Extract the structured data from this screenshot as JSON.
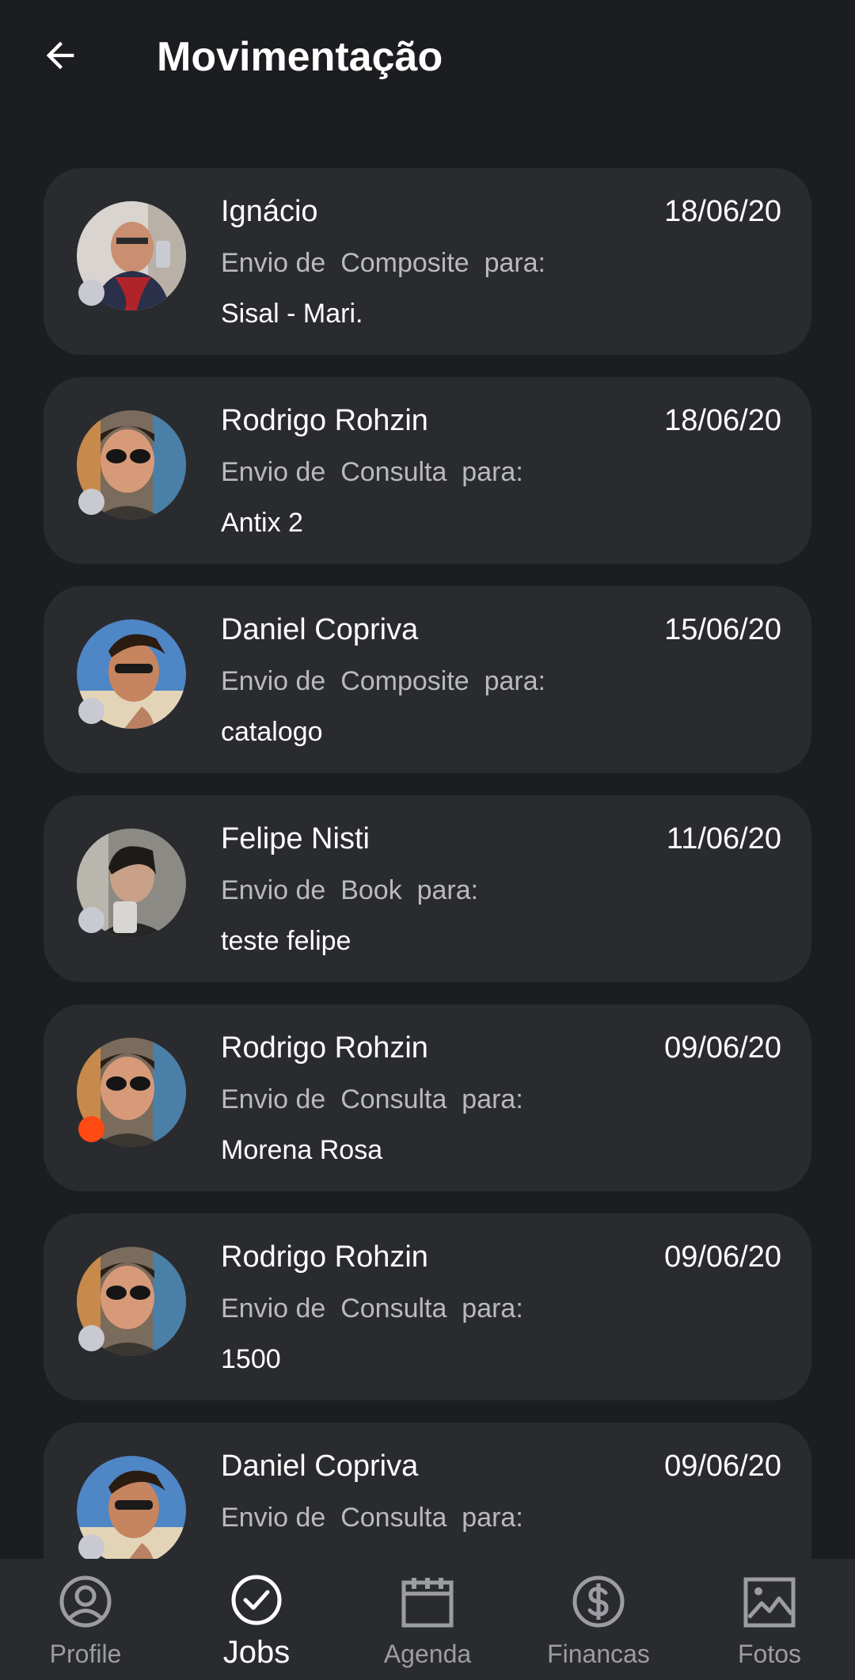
{
  "header": {
    "title": "Movimentação",
    "back_icon": "arrow-left-icon"
  },
  "items": [
    {
      "name": "Ignácio",
      "date": "18/06/20",
      "desc": "Envio de  Composite  para:",
      "target": "Sisal - Mari.",
      "status": "read"
    },
    {
      "name": "Rodrigo Rohzin",
      "date": "18/06/20",
      "desc": "Envio de  Consulta  para:",
      "target": "Antix 2",
      "status": "read"
    },
    {
      "name": "Daniel Copriva",
      "date": "15/06/20",
      "desc": "Envio de  Composite  para:",
      "target": "catalogo",
      "status": "read"
    },
    {
      "name": "Felipe Nisti",
      "date": "11/06/20",
      "desc": "Envio de  Book  para:",
      "target": "teste felipe",
      "status": "read"
    },
    {
      "name": "Rodrigo Rohzin",
      "date": "09/06/20",
      "desc": "Envio de  Consulta  para:",
      "target": "Morena Rosa",
      "status": "unread"
    },
    {
      "name": "Rodrigo Rohzin",
      "date": "09/06/20",
      "desc": "Envio de  Consulta  para:",
      "target": "1500",
      "status": "read"
    },
    {
      "name": "Daniel Copriva",
      "date": "09/06/20",
      "desc": "Envio de  Consulta  para:",
      "target": "",
      "status": "read"
    }
  ],
  "nav": [
    {
      "label": "Profile",
      "icon": "profile-icon",
      "active": false
    },
    {
      "label": "Jobs",
      "icon": "check-circle-icon",
      "active": true
    },
    {
      "label": "Agenda",
      "icon": "calendar-icon",
      "active": false
    },
    {
      "label": "Financas",
      "icon": "dollar-icon",
      "active": false
    },
    {
      "label": "Fotos",
      "icon": "image-icon",
      "active": false
    }
  ],
  "colors": {
    "background": "#1c1d20",
    "card": "#2a2b2f",
    "unread_dot": "#ff4a13",
    "read_dot": "#c9c9d1",
    "muted_text": "#b9b9c0"
  }
}
